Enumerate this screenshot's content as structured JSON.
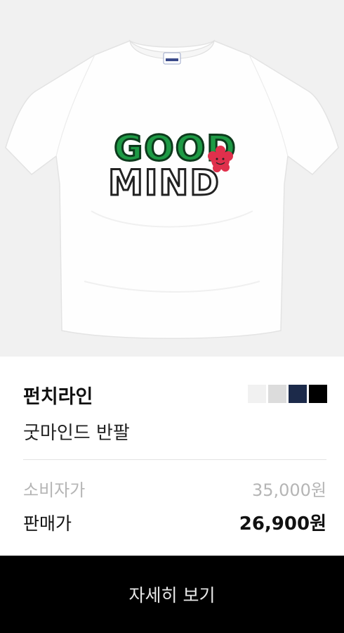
{
  "product": {
    "image_alt": "white t-shirt with GOOD MIND print",
    "brand": "펀치라인",
    "name": "굿마인드 반팔",
    "swatches": [
      {
        "name": "white",
        "color": "#f1f1f1"
      },
      {
        "name": "light-gray",
        "color": "#dcdcdc"
      },
      {
        "name": "navy",
        "color": "#1c2a4a"
      },
      {
        "name": "black",
        "color": "#000000"
      }
    ]
  },
  "pricing": {
    "retail_label": "소비자가",
    "retail_value": "35,000원",
    "sale_label": "판매가",
    "sale_value": "26,900원"
  },
  "cta": {
    "detail_label": "자세히 보기"
  },
  "graphic": {
    "print_line1": "GOOD",
    "print_line2": "MIND"
  }
}
